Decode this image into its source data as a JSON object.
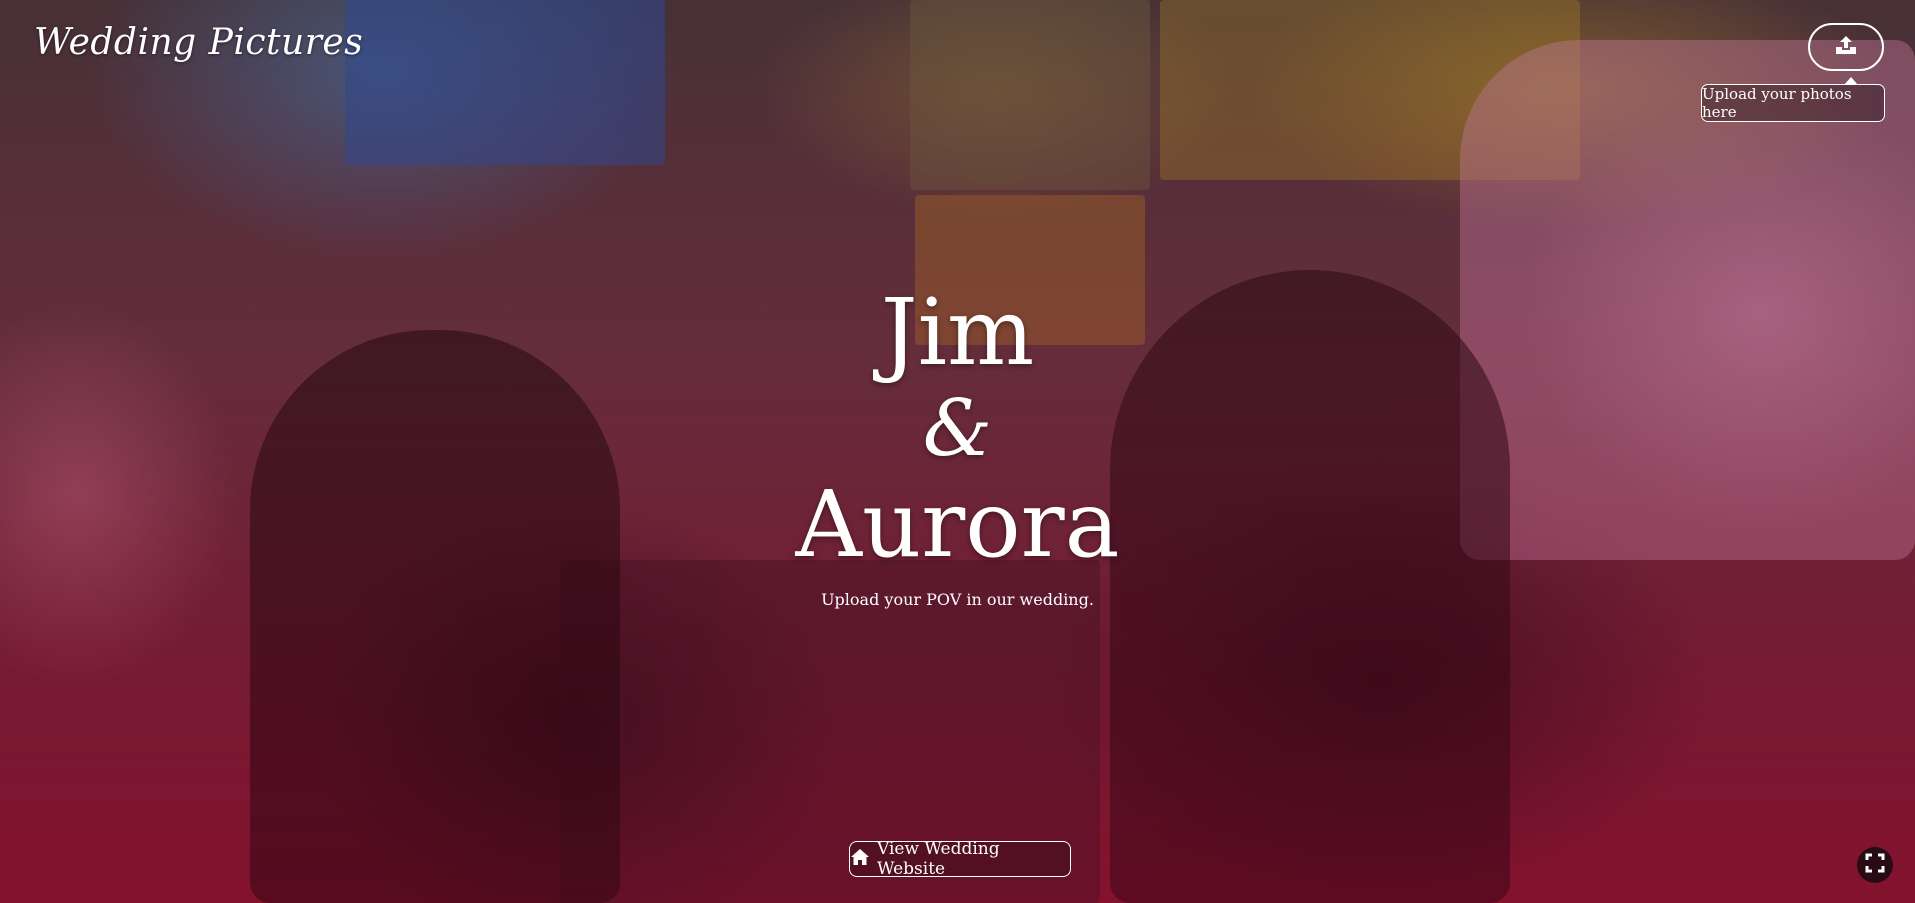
{
  "brand": {
    "title": "Wedding Pictures"
  },
  "upload": {
    "icon": "upload-icon",
    "tooltip": "Upload your photos here"
  },
  "hero": {
    "name1": "Jim",
    "ampersand": "&",
    "name2": "Aurora",
    "tagline": "Upload your POV in our wedding."
  },
  "footer": {
    "site_button_icon": "home-icon",
    "site_button_label": "View Wedding Website",
    "fullscreen_icon": "fullscreen-icon"
  },
  "colors": {
    "overlay_tint": "#7a2138",
    "text": "#ffffff"
  }
}
